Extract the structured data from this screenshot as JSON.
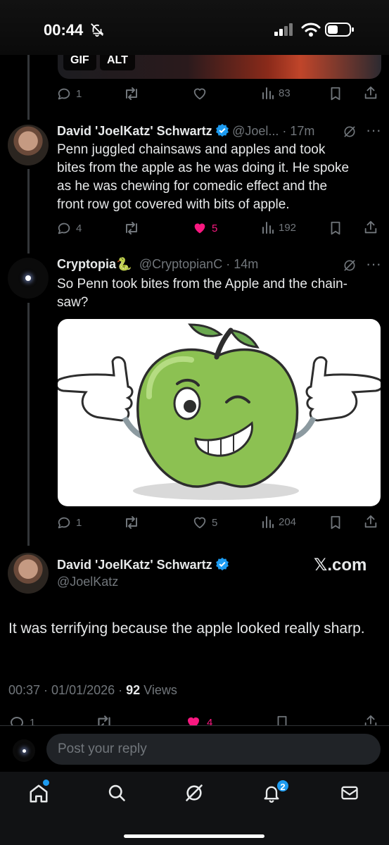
{
  "status_bar": {
    "time": "00:44"
  },
  "top_tweet": {
    "media_badges": [
      "GIF",
      "ALT"
    ],
    "actions": {
      "replies": "1",
      "retweets": "",
      "likes": "",
      "views": "83"
    }
  },
  "tweets": [
    {
      "name": "David 'JoelKatz' Schwartz",
      "handle": "@Joel...",
      "time": "17m",
      "text": "Penn juggled chainsaws and apples and took bites from the apple as he was doing it. He spoke as he was chewing for comedic effect and the front row got covered with bits of apple.",
      "actions": {
        "replies": "4",
        "retweets": "",
        "likes": "5",
        "views": "192"
      }
    },
    {
      "name": "Cryptopia🐍",
      "handle": "@CryptopianC",
      "time": "14m",
      "text": "So Penn took bites from the Apple and the chain-saw?",
      "actions": {
        "replies": "1",
        "retweets": "",
        "likes": "5",
        "views": "204"
      }
    }
  ],
  "main_tweet": {
    "name": "David 'JoelKatz' Schwartz",
    "handle": "@JoelKatz",
    "brand": "𝕏.com",
    "text": "It was terrifying because the apple looked really sharp.",
    "timestamp": "00:37 · 01/01/2026 · ",
    "views_count": "92",
    "views_label": " Views",
    "actions": {
      "replies": "1",
      "retweets": "",
      "likes": "4"
    }
  },
  "reply": {
    "placeholder": "Post your reply"
  },
  "tab_bar": {
    "notifications_badge": "2"
  },
  "colors": {
    "accent": "#1d9bf0",
    "like": "#f91880",
    "muted": "#71767b",
    "background": "#000000"
  }
}
